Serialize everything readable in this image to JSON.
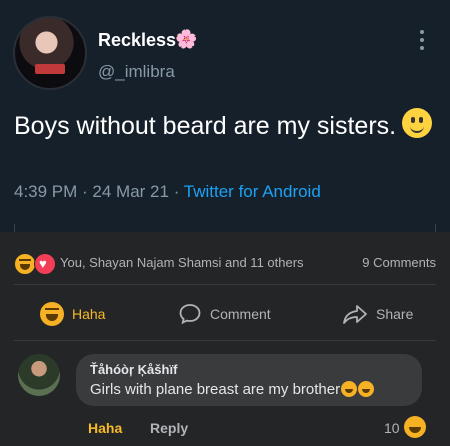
{
  "tweet": {
    "author_name": "Reckless",
    "author_emoji": "🌸",
    "handle": "@_imlibra",
    "text": "Boys without beard are my sisters.",
    "time": "4:39 PM",
    "separator": " · ",
    "date": "24 Mar 21",
    "source": "Twitter for Android"
  },
  "post": {
    "reactions_text": "You, Shayan Najam Shamsi and 11 others",
    "comments_count": "9 Comments",
    "actions": {
      "haha": "Haha",
      "comment": "Comment",
      "share": "Share"
    }
  },
  "comment": {
    "author": "Ťåhóòŗ Ķåšhïf",
    "text": "Girls with plane breast are my brother",
    "haha_label": "Haha",
    "reply_label": "Reply",
    "reaction_count": "10"
  },
  "colors": {
    "twitter_bg": "#15202b",
    "twitter_blue": "#1da1f2",
    "fb_bg": "#242526",
    "haha_yellow": "#f7b928"
  }
}
